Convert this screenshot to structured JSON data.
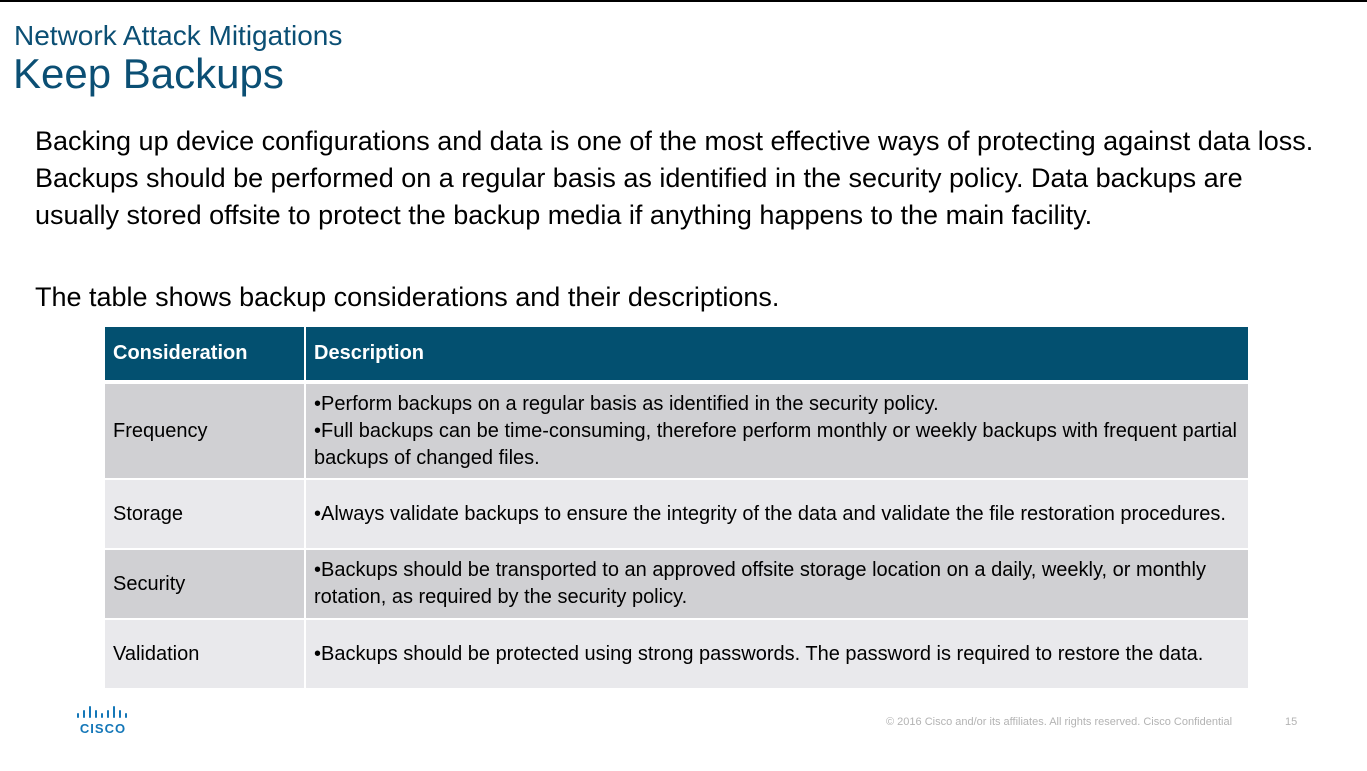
{
  "slide": {
    "subtitle": "Network Attack Mitigations",
    "title": "Keep Backups",
    "paragraph1": "Backing up device configurations and data is one of the most effective ways of protecting against data loss. Backups should be performed on a regular basis as identified in the security policy. Data backups are usually stored offsite to protect the backup media if anything happens to the main facility.",
    "paragraph2": "The table shows backup considerations and their descriptions."
  },
  "table": {
    "headers": [
      "Consideration",
      "Description"
    ],
    "rows": [
      {
        "consideration": "Frequency",
        "bullets": [
          "•Perform backups on a regular basis as identified in the security policy.",
          "•Full backups can be time-consuming, therefore perform monthly or weekly backups with frequent partial backups of changed files."
        ]
      },
      {
        "consideration": "Storage",
        "bullets": [
          "•Always validate backups to ensure the integrity of the data and validate the file restoration procedures."
        ]
      },
      {
        "consideration": "Security",
        "bullets": [
          "•Backups should be transported to an approved offsite storage location on a daily, weekly, or monthly rotation, as required by the security policy."
        ]
      },
      {
        "consideration": "Validation",
        "bullets": [
          "•Backups should be protected using strong passwords. The password is required to restore the data."
        ]
      }
    ]
  },
  "footer": {
    "logo_text": "CISCO",
    "copyright": "© 2016  Cisco and/or its affiliates. All rights reserved.   Cisco Confidential",
    "page_number": "15"
  },
  "colors": {
    "title": "#0b4f74",
    "table_header": "#035070",
    "row_dark": "#d0d0d3",
    "row_light": "#e9e9ec",
    "logo": "#1477b8"
  },
  "icons": [
    "cisco-logo-icon"
  ]
}
